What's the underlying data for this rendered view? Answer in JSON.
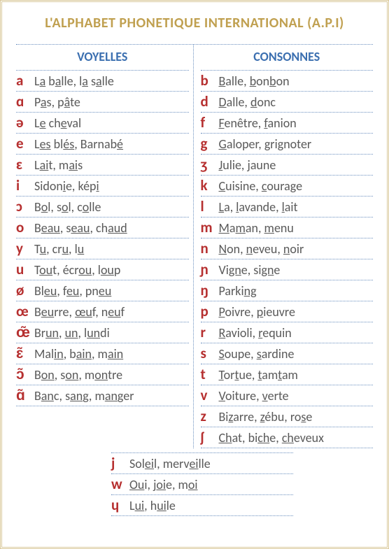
{
  "title": "L'ALPHABET PHONETIQUE INTERNATIONAL (A.P.I)",
  "headers": {
    "vowels": "VOYELLES",
    "consonants": "CONSONNES"
  },
  "vowels": [
    {
      "sym": "a",
      "ex": "L<u>a</u> b<u>a</u>lle, l<u>a</u> s<u>a</u>lle"
    },
    {
      "sym": "ɑ",
      "ex": "P<u>a</u>s, p<u>â</u>te"
    },
    {
      "sym": "ə",
      "ex": "L<u>e</u> ch<u>e</u>val"
    },
    {
      "sym": "e",
      "ex": "L<u>es</u> bl<u>és</u>, Barnab<u>é</u>"
    },
    {
      "sym": "ɛ",
      "ex": "L<u>ai</u>t, m<u>ai</u>s"
    },
    {
      "sym": "i",
      "ex": "Sidon<u>i</u>e, kép<u>i</u>"
    },
    {
      "sym": "ɔ",
      "ex": "B<u>o</u>l, s<u>o</u>l, c<u>o</u>lle"
    },
    {
      "sym": "o",
      "ex": "B<u>eau</u>, s<u>eau</u>, ch<u>aud</u>"
    },
    {
      "sym": "y",
      "ex": "T<u>u</u>, cr<u>u</u>, l<u>u</u>"
    },
    {
      "sym": "u",
      "ex": "T<u>ou</u>t, écr<u>ou</u>, l<u>ou</u>p"
    },
    {
      "sym": "ø",
      "ex": "Bl<u>eu</u>, f<u>eu</u>, pn<u>eu</u>"
    },
    {
      "sym": "œ",
      "ex": "B<u>eu</u>rre, <u>œu</u>f, n<u>eu</u>f"
    },
    {
      "sym": "œ̃",
      "ex": "Br<u>un</u>, <u>un</u>, l<u>un</u>di"
    },
    {
      "sym": "ɛ̃",
      "ex": "Mal<u>in</u>, b<u>ain</u>, m<u>ain</u>"
    },
    {
      "sym": "ɔ̃",
      "ex": "B<u>on</u>, s<u>on</u>, m<u>on</u>tre"
    },
    {
      "sym": "ɑ̃",
      "ex": "B<u>an</u>c, s<u>an</u>g, m<u>an</u>ger"
    }
  ],
  "consonants": [
    {
      "sym": "b",
      "ex": "<u>B</u>alle, <u>b</u>on<u>b</u>on"
    },
    {
      "sym": "d",
      "ex": "<u>D</u>alle, <u>d</u>onc"
    },
    {
      "sym": "f",
      "ex": "<u>F</u>enêtre, <u>f</u>anion"
    },
    {
      "sym": "g",
      "ex": "<u>G</u>aloper, <u>g</u>ri<u>g</u>noter"
    },
    {
      "sym": "ʒ",
      "ex": "<u>J</u>ulie, <u>j</u>aune"
    },
    {
      "sym": "k",
      "ex": "<u>C</u>uisine, <u>c</u>ourage"
    },
    {
      "sym": "l",
      "ex": "<u>L</u>a, <u>l</u>avande, <u>l</u>ait"
    },
    {
      "sym": "m",
      "ex": "<u>M</u>a<u>m</u>an, <u>m</u>enu"
    },
    {
      "sym": "n",
      "ex": "<u>N</u>on, <u>n</u>eveu, <u>n</u>oir"
    },
    {
      "sym": "ɲ",
      "ex": "Vi<u>gn</u>e, si<u>gn</u>e"
    },
    {
      "sym": "ŋ",
      "ex": "Parki<u>ng</u>"
    },
    {
      "sym": "p",
      "ex": "<u>P</u>oivre, <u>p</u>ieuvre"
    },
    {
      "sym": "r",
      "ex": "<u>R</u>avioli, <u>r</u>equin"
    },
    {
      "sym": "s",
      "ex": "<u>S</u>oupe, <u>s</u>ardine"
    },
    {
      "sym": "t",
      "ex": "<u>T</u>or<u>t</u>ue, <u>t</u>am<u>t</u>am"
    },
    {
      "sym": "v",
      "ex": "<u>V</u>oiture, <u>v</u>erte"
    },
    {
      "sym": "z",
      "ex": "Bi<u>z</u>arre, <u>z</u>ébu, ro<u>s</u>e"
    },
    {
      "sym": "ʃ",
      "ex": "<u>Ch</u>at, bi<u>ch</u>e, <u>ch</u>eveux"
    }
  ],
  "semivowels": [
    {
      "sym": "j",
      "ex": "Sol<u>ei</u>l, merv<u>ei</u>lle"
    },
    {
      "sym": "w",
      "ex": "<u>Ou</u>i, j<u>oi</u>e, m<u>oi</u>"
    },
    {
      "sym": "ɥ",
      "ex": "L<u>ui</u>, h<u>ui</u>le"
    }
  ]
}
